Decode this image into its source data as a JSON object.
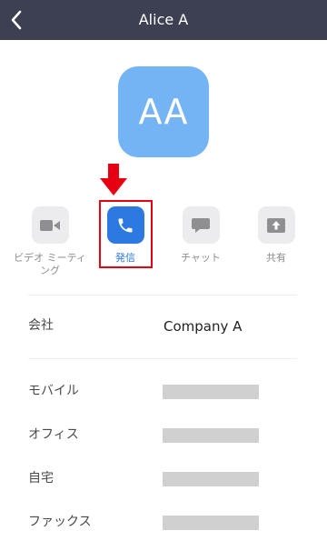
{
  "header": {
    "title": "Alice A",
    "back_icon": "chevron-left-icon",
    "background": "#3d3f52"
  },
  "avatar": {
    "initials": "AA",
    "color": "#74b3f4"
  },
  "annotation": {
    "arrow_color": "#e60012",
    "highlight_color": "#e60012"
  },
  "actions": [
    {
      "label": "ビデオ ミーティング",
      "icon": "video-camera-icon"
    },
    {
      "label": "発信",
      "icon": "phone-icon",
      "color": "#2d79e2"
    },
    {
      "label": "チャット",
      "icon": "chat-bubble-icon"
    },
    {
      "label": "共有",
      "icon": "share-screen-icon"
    }
  ],
  "details": {
    "company": {
      "label": "会社",
      "value": "Company A"
    },
    "mobile": {
      "label": "モバイル"
    },
    "office": {
      "label": "オフィス"
    },
    "home": {
      "label": "自宅"
    },
    "fax": {
      "label": "ファックス"
    }
  }
}
